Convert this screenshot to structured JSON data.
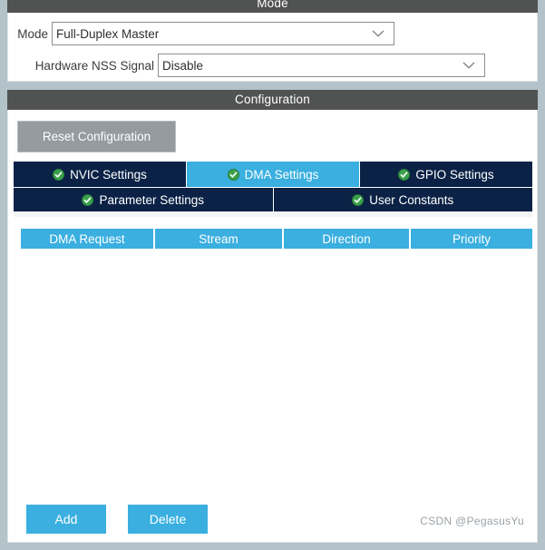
{
  "mode_section": {
    "title": "Mode",
    "fields": [
      {
        "label": "Mode",
        "value": "Full-Duplex Master",
        "icon": "chevron-down-icon",
        "label_width": 48,
        "select_width": 378
      },
      {
        "label": "Hardware NSS Signal",
        "value": "Disable",
        "icon": "chevron-down-icon",
        "label_width": 165,
        "select_width": 361
      }
    ]
  },
  "configuration_section": {
    "title": "Configuration",
    "reset_button": {
      "label": "Reset Configuration",
      "enabled": false
    },
    "tabs": {
      "row1": [
        {
          "label": "NVIC Settings",
          "icon": "check-circle-icon",
          "active": false
        },
        {
          "label": "DMA Settings",
          "icon": "check-circle-icon",
          "active": true
        },
        {
          "label": "GPIO Settings",
          "icon": "check-circle-icon",
          "active": false
        }
      ],
      "row2": [
        {
          "label": "Parameter Settings",
          "icon": "check-circle-icon",
          "active": false
        },
        {
          "label": "User Constants",
          "icon": "check-circle-icon",
          "active": false
        }
      ]
    },
    "table": {
      "columns": [
        "DMA Request",
        "Stream",
        "Direction",
        "Priority"
      ],
      "rows": []
    },
    "actions": [
      {
        "label": "Add"
      },
      {
        "label": "Delete"
      }
    ]
  },
  "watermark": "CSDN @PegasusYu",
  "colors": {
    "header_bar": "#515352",
    "window_bg": "#b4c2c9",
    "tab_inactive": "#0b2246",
    "tab_active": "#3aafe0",
    "accent_blue": "#3aafe0",
    "check_green": "#3bA24c",
    "disabled_gray": "#949ba1"
  }
}
